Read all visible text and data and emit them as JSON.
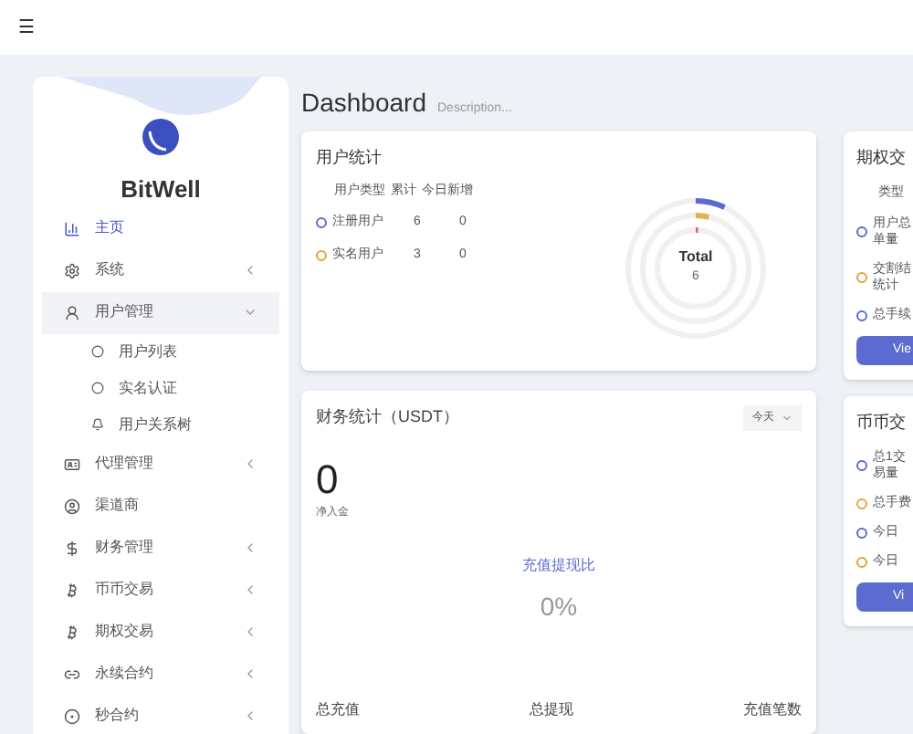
{
  "topbar": {
    "menu_glyph": "☰"
  },
  "sidebar": {
    "brand": "BitWell",
    "items": [
      {
        "label": "主页",
        "kind": "link",
        "selected": true,
        "expanded": false
      },
      {
        "label": "系统",
        "kind": "menu",
        "selected": false,
        "expanded": false
      },
      {
        "label": "用户管理",
        "kind": "menu",
        "selected": false,
        "expanded": true,
        "children": [
          {
            "label": "用户列表"
          },
          {
            "label": "实名认证"
          },
          {
            "label": "用户关系树"
          }
        ]
      },
      {
        "label": "代理管理",
        "kind": "menu",
        "selected": false,
        "expanded": false
      },
      {
        "label": "渠道商",
        "kind": "link",
        "selected": false,
        "expanded": false
      },
      {
        "label": "财务管理",
        "kind": "menu",
        "selected": false,
        "expanded": false
      },
      {
        "label": "币币交易",
        "kind": "menu",
        "selected": false,
        "expanded": false
      },
      {
        "label": "期权交易",
        "kind": "menu",
        "selected": false,
        "expanded": false
      },
      {
        "label": "永续合约",
        "kind": "menu",
        "selected": false,
        "expanded": false
      },
      {
        "label": "秒合约",
        "kind": "menu",
        "selected": false,
        "expanded": false
      }
    ]
  },
  "header": {
    "title": "Dashboard",
    "description": "Description..."
  },
  "user_stats": {
    "title": "用户统计",
    "columns": [
      "用户类型",
      "累计",
      "今日新增"
    ],
    "rows": [
      {
        "type": "注册用户",
        "total": "6",
        "today": "0",
        "color": "#5b6bd0"
      },
      {
        "type": "实名用户",
        "total": "3",
        "today": "0",
        "color": "#e8a23a"
      }
    ],
    "donut": {
      "label": "Total",
      "value": "6"
    }
  },
  "finance": {
    "title": "财务统计（USDT）",
    "period": "今天",
    "net": "0",
    "net_label": "净入金",
    "ratio_label": "充值提现比",
    "ratio": "0%",
    "footer": [
      "总充值",
      "总提现",
      "充值笔数"
    ]
  },
  "right_cards": [
    {
      "title": "期权交",
      "header": "类型",
      "rows": [
        {
          "label": "用户总单量",
          "color": "#5b6bd0"
        },
        {
          "label": "交割结统计",
          "color": "#e8a23a"
        },
        {
          "label": "总手续",
          "color": "#5b6bd0"
        }
      ],
      "button": "Vie"
    },
    {
      "title": "币币交",
      "rows": [
        {
          "label": "总1交易量",
          "color": "#5b6bd0"
        },
        {
          "label": "总手费",
          "color": "#e8a23a"
        },
        {
          "label": "今日",
          "color": "#5b6bd0"
        },
        {
          "label": "今日",
          "color": "#e8a23a"
        }
      ],
      "button": "Vi"
    }
  ]
}
